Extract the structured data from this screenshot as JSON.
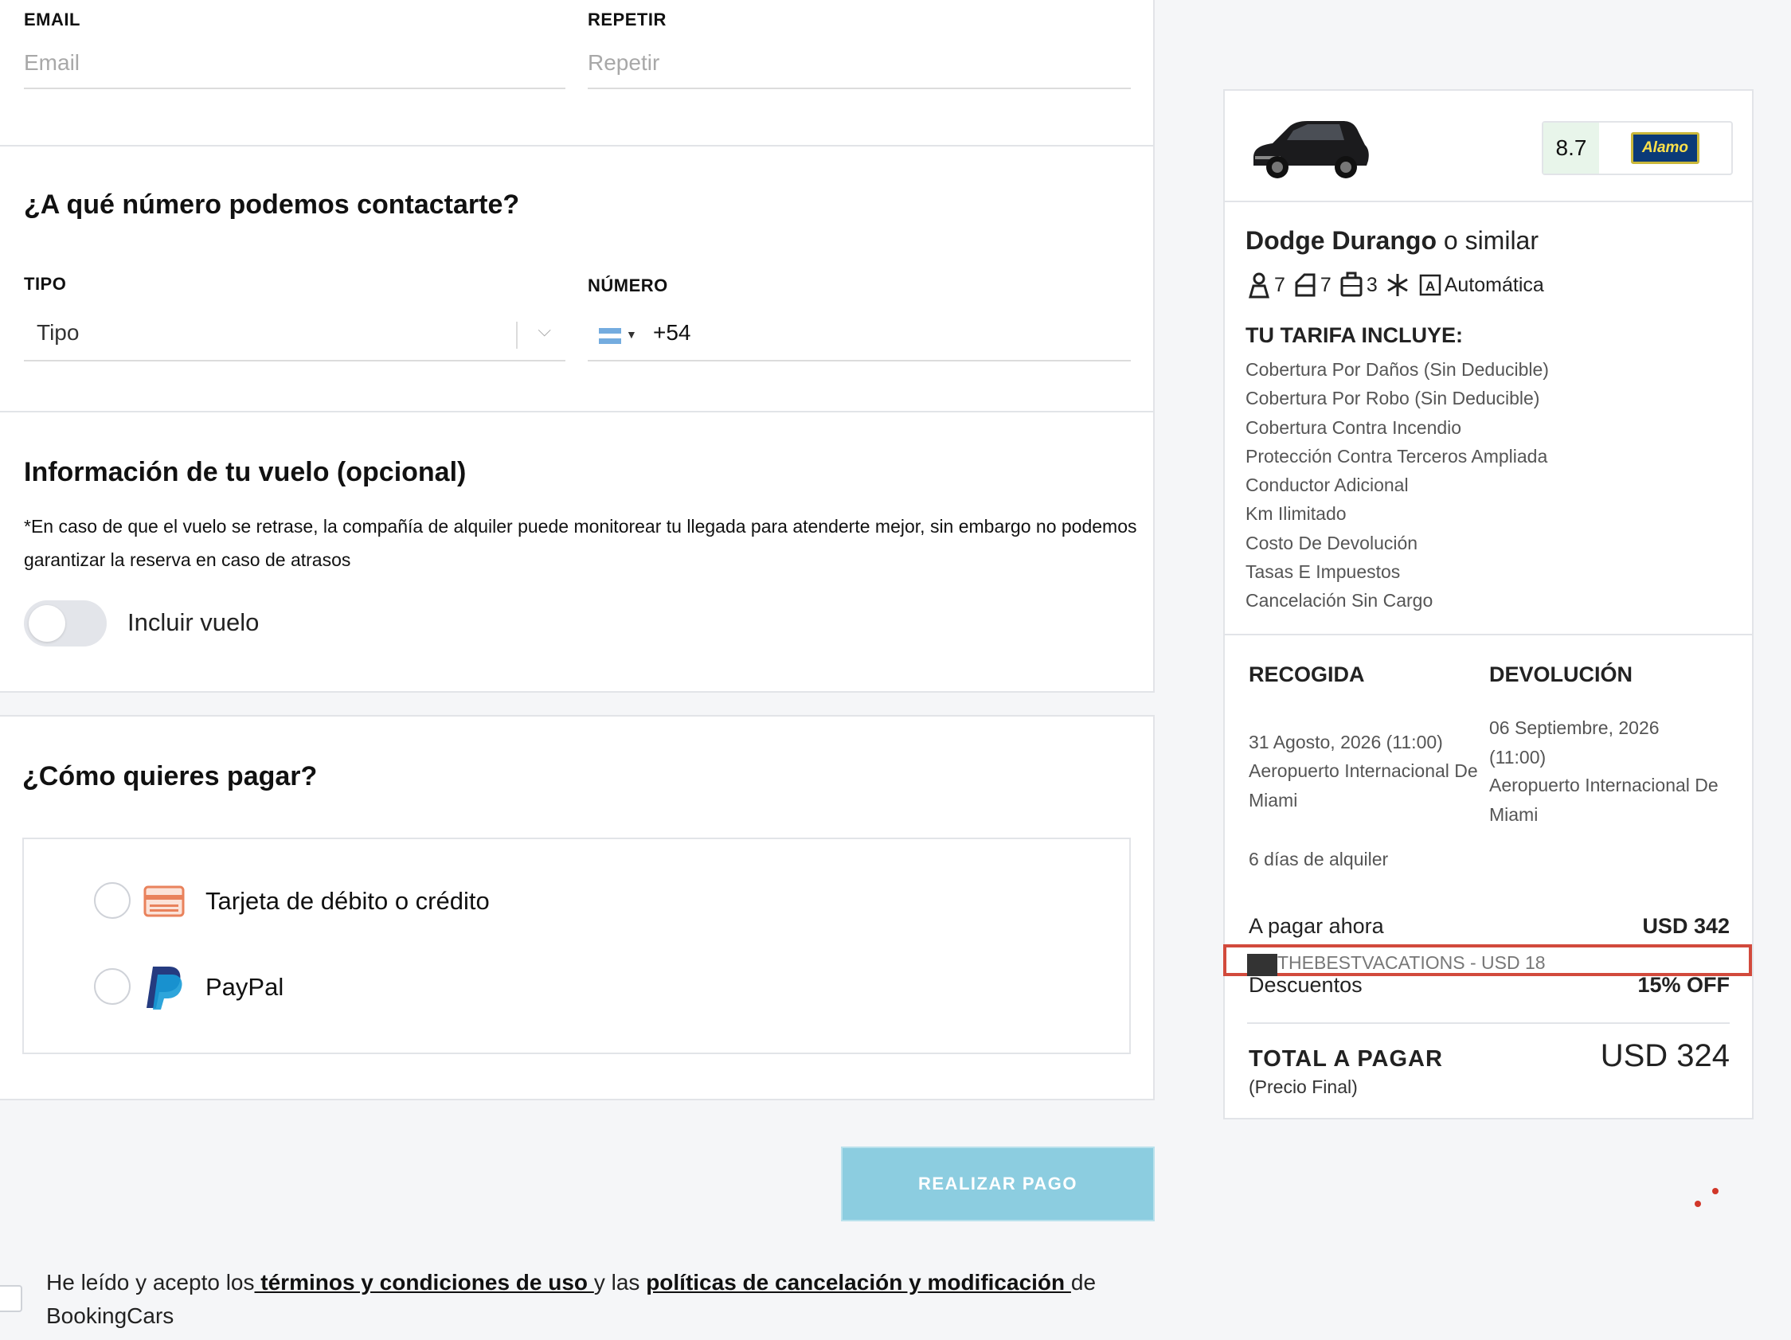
{
  "contact": {
    "email_label": "EMAIL",
    "email_placeholder": "Email",
    "repeat_label": "REPETIR",
    "repeat_placeholder": "Repetir"
  },
  "phone": {
    "title": "¿A qué número podemos contactarte?",
    "type_label": "TIPO",
    "type_value": "Tipo",
    "number_label": "NÚMERO",
    "number_value": "+54"
  },
  "flight": {
    "title": "Información de tu vuelo (opcional)",
    "note": "*En caso de que el vuelo se retrase, la compañía de alquiler puede monitorear tu llegada para atenderte mejor, sin embargo no podemos garantizar la reserva en caso de atrasos",
    "toggle_label": "Incluir vuelo",
    "toggle_on": false
  },
  "payment": {
    "title": "¿Cómo quieres pagar?",
    "options": [
      "Tarjeta de débito o crédito",
      "PayPal"
    ],
    "button": "REALIZAR PAGO"
  },
  "terms": {
    "text1": "He leído y acepto los",
    "link1": " términos y condiciones de uso ",
    "text2": "y las ",
    "link2": "políticas de cancelación y modificación ",
    "text3": "de BookingCars"
  },
  "summary": {
    "rating": "8.7",
    "brand": "Alamo",
    "car_name": "Dodge Durango",
    "car_suffix": " o similar",
    "specs": {
      "seats": "7",
      "doors": "7",
      "bags": "3",
      "transmission": "Automática"
    },
    "includes_title": "TU TARIFA INCLUYE:",
    "includes": [
      "Cobertura Por Daños (Sin Deducible)",
      "Cobertura Por Robo (Sin Deducible)",
      "Cobertura Contra Incendio",
      "Protección Contra Terceros Ampliada",
      "Conductor Adicional",
      "Km Ilimitado",
      "Costo De Devolución",
      "Tasas E Impuestos",
      "Cancelación Sin Cargo"
    ],
    "pickup_title": "RECOGIDA",
    "pickup_date": "31 Agosto, 2026 (11:00)",
    "pickup_place": "Aeropuerto Internacional De Miami",
    "dropoff_title": "DEVOLUCIÓN",
    "dropoff_date": "06 Septiembre, 2026 (11:00)",
    "dropoff_place": "Aeropuerto Internacional De Miami",
    "days": "6 días de alquiler",
    "pay_now_label": "A pagar ahora",
    "pay_now_value": "USD 342",
    "promo": "THEBESTVACATIONS - USD 18",
    "discount_label": "Descuentos",
    "discount_value": "15% OFF",
    "total_label": "TOTAL A PAGAR",
    "total_sub": "(Precio Final)",
    "total_value": "USD 324"
  },
  "colors": {
    "accent_button": "#8ccde0",
    "highlight_border": "#d24a3c",
    "rating_bg": "#e8f5ea"
  }
}
